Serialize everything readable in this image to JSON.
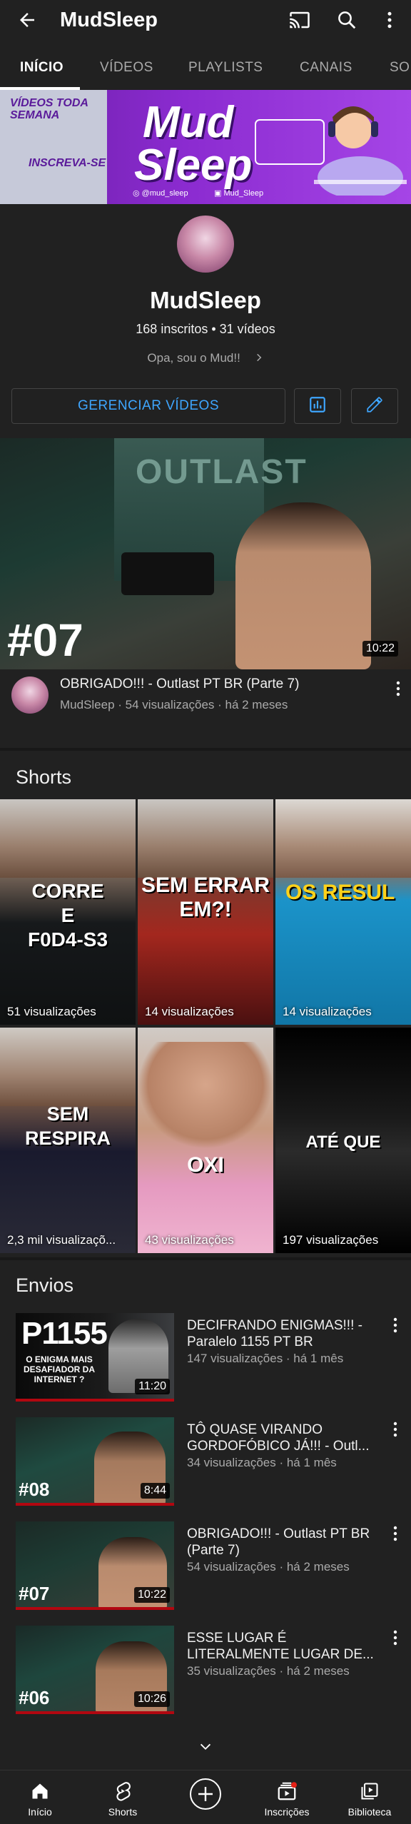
{
  "header": {
    "title": "MudSleep",
    "back_icon": "arrow-back-icon",
    "cast_icon": "cast-icon",
    "search_icon": "search-icon",
    "more_icon": "more-vert-icon"
  },
  "tabs": [
    {
      "label": "INÍCIO",
      "active": true
    },
    {
      "label": "VÍDEOS"
    },
    {
      "label": "PLAYLISTS"
    },
    {
      "label": "CANAIS"
    },
    {
      "label": "SOB"
    }
  ],
  "banner": {
    "tagline": "VÍDEOS TODA SEMANA",
    "subscribe": "INSCREVA-SE",
    "title_line1": "Mud",
    "title_line2": "Sleep",
    "instagram": "@mud_sleep",
    "twitch": "Mud_Sleep"
  },
  "channel": {
    "name": "MudSleep",
    "stats": "168 inscritos • 31 vídeos",
    "description": "Opa, sou o Mud!!",
    "manage_label": "GERENCIAR VÍDEOS",
    "analytics_icon": "analytics-icon",
    "edit_icon": "edit-pencil-icon"
  },
  "featured": {
    "overlay_text": "OUTLAST",
    "episode": "#07",
    "duration": "10:22",
    "title": "OBRIGADO!!! - Outlast PT BR (Parte 7)",
    "meta": "MudSleep · 54 visualizações · há 2 meses"
  },
  "shorts": {
    "section_title": "Shorts",
    "items": [
      {
        "overlay": "CORRE\nE\nF0D4-S3",
        "views": "51 visualizações"
      },
      {
        "overlay": "SEM ERRAR\nEM?!",
        "views": "14 visualizações"
      },
      {
        "overlay": "OS RESUL",
        "views": "14 visualizações"
      },
      {
        "overlay": "SEM\nRESPIRA",
        "views": "2,3 mil visualizaçõ..."
      },
      {
        "overlay": "OXI",
        "views": "43 visualizações"
      },
      {
        "overlay": "ATÉ QUE",
        "views": "197 visualizações"
      }
    ]
  },
  "uploads": {
    "section_title": "Envios",
    "items": [
      {
        "title": "DECIFRANDO ENIGMAS!!! - Paralelo 1155 PT BR",
        "meta": "147 visualizações · há 1 mês",
        "duration": "11:20",
        "thumb_text": "P1155",
        "thumb_sub": "O ENIGMA MAIS DESAFIADOR DA INTERNET ?"
      },
      {
        "title": "TÔ QUASE VIRANDO GORDOFÓBICO JÁ!!! - Outl...",
        "meta": "34 visualizações · há 1 mês",
        "duration": "8:44",
        "episode": "#08"
      },
      {
        "title": "OBRIGADO!!! - Outlast PT BR (Parte 7)",
        "meta": "54 visualizações · há 2 meses",
        "duration": "10:22",
        "episode": "#07"
      },
      {
        "title": "ESSE LUGAR É LITERALMENTE LUGAR DE...",
        "meta": "35 visualizações · há 2 meses",
        "duration": "10:26",
        "episode": "#06"
      }
    ]
  },
  "bottom_nav": [
    {
      "label": "Início",
      "icon": "home-icon"
    },
    {
      "label": "Shorts",
      "icon": "shorts-icon"
    },
    {
      "label": "",
      "icon": "create-plus-icon"
    },
    {
      "label": "Inscrições",
      "icon": "subscriptions-icon"
    },
    {
      "label": "Biblioteca",
      "icon": "library-icon"
    }
  ]
}
